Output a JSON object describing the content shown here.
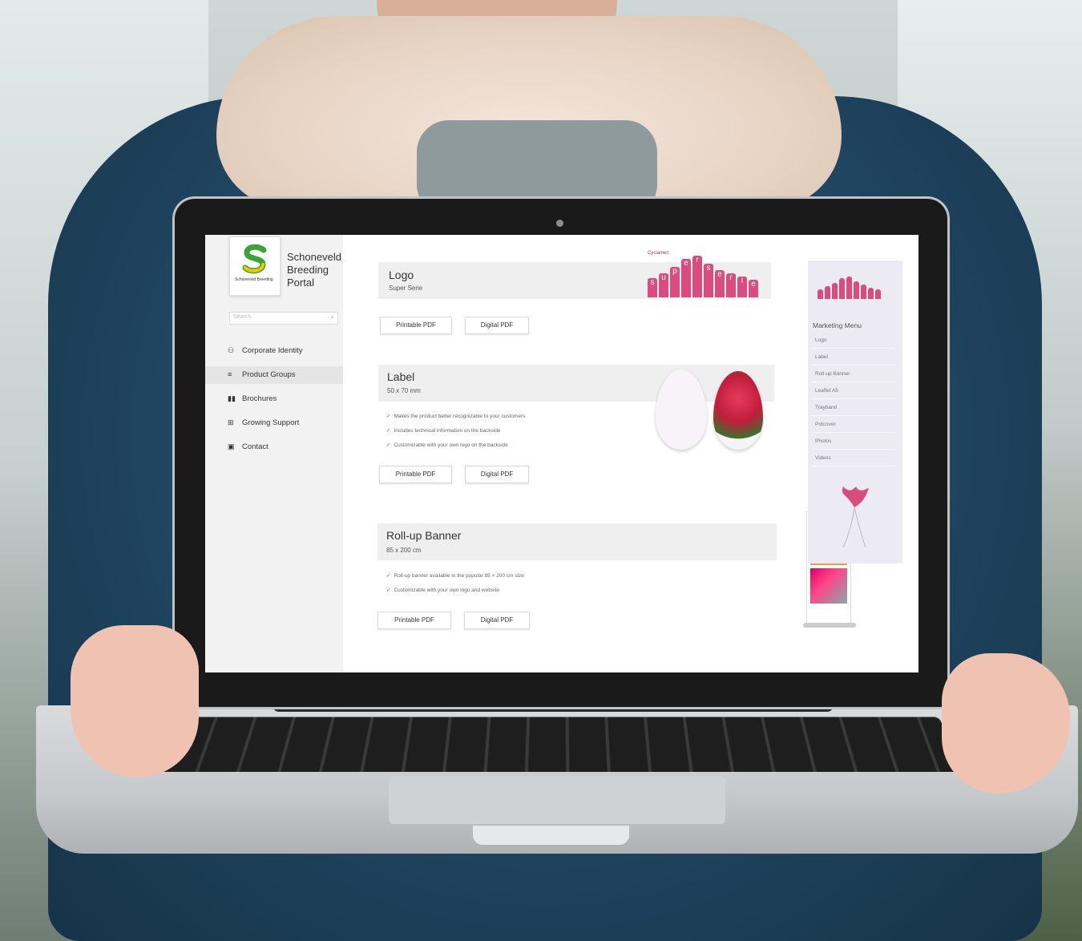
{
  "sidebar": {
    "brand_line1": "Schoneveld",
    "brand_line2": "Breeding",
    "brand_line3": "Portal",
    "logo_small_text": "Schoneveld Breeding",
    "search_placeholder": "Search",
    "items": [
      {
        "label": "Corporate Identity",
        "icon": "people-icon",
        "glyph": "&"
      },
      {
        "label": "Product Groups",
        "icon": "list-icon",
        "glyph": "≡"
      },
      {
        "label": "Brochures",
        "icon": "book-icon",
        "glyph": "▮▮"
      },
      {
        "label": "Growing Support",
        "icon": "plus-box-icon",
        "glyph": "⊞"
      },
      {
        "label": "Contact",
        "icon": "contact-card-icon",
        "glyph": "▣"
      }
    ],
    "active_index": 1
  },
  "sections": {
    "logo": {
      "title": "Logo",
      "subtitle": "Super Serie",
      "printable_label": "Printable PDF",
      "digital_label": "Digital PDF",
      "product_caption": "Cyclamen",
      "product_word": "superserie"
    },
    "label": {
      "title": "Label",
      "subtitle": "50 x 70 mm",
      "features": [
        "Makes the product better recognizable to your customers",
        "Includes technical information on the backside",
        "Customizable with your own logo on the backside"
      ],
      "printable_label": "Printable PDF",
      "digital_label": "Digital PDF"
    },
    "rollup": {
      "title": "Roll-up Banner",
      "subtitle": "85 x 200 cm",
      "features": [
        "Roll-up banner available in the popular 85 × 200 cm size",
        "Customizable with your own logo and website"
      ],
      "printable_label": "Printable PDF",
      "digital_label": "Digital PDF"
    },
    "check_glyph": "✓"
  },
  "marketing_menu": {
    "title": "Marketing Menu",
    "items": [
      "Logo",
      "Label",
      "Roll-up Banner",
      "Leaflet A5",
      "Trayband",
      "Potcover",
      "Photos",
      "Videos"
    ]
  },
  "colors": {
    "accent_pink": "#d94c7e",
    "sidebar_bg": "#f2f2f2",
    "band_bg": "#efefef",
    "menu_bg": "#eceaf2",
    "logo_green": "#3aa535",
    "logo_yellow": "#f2c500"
  }
}
